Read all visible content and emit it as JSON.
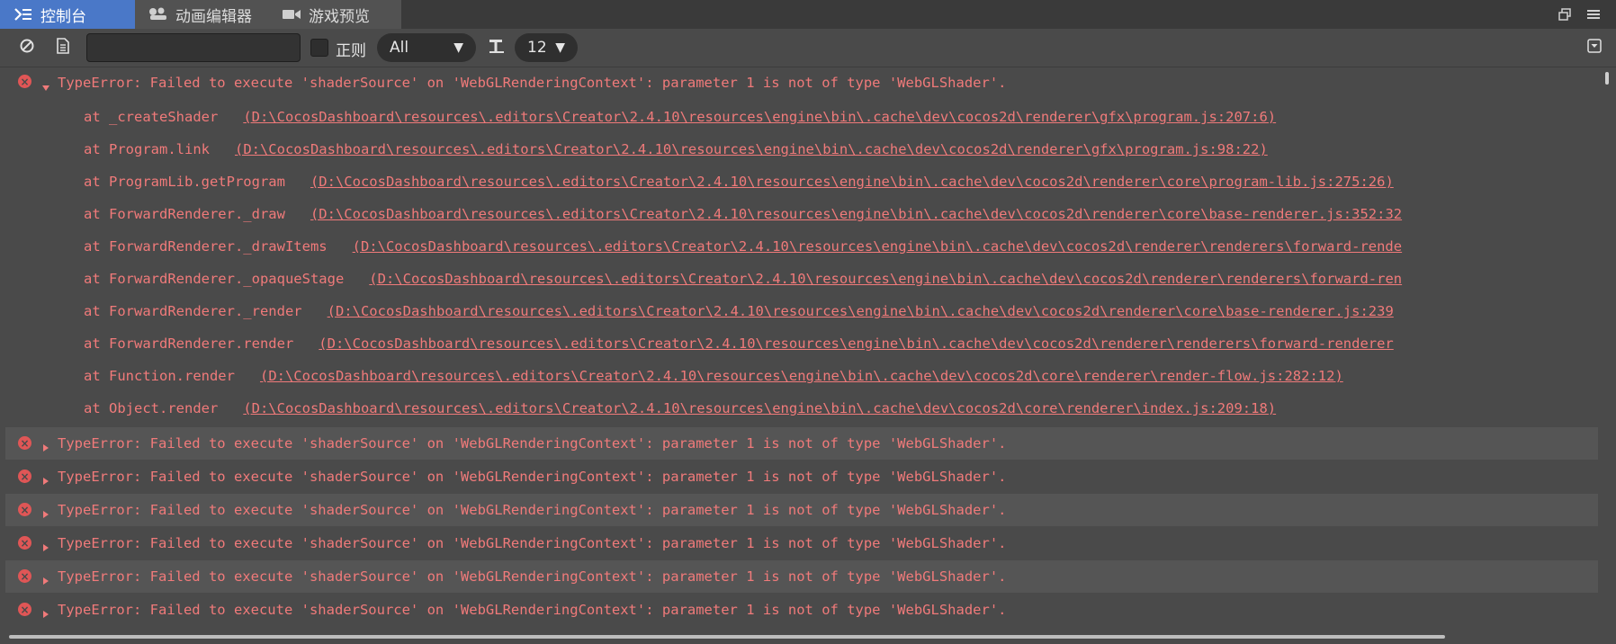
{
  "tabs": [
    {
      "label": "控制台",
      "icon": "console-icon",
      "active": true
    },
    {
      "label": "动画编辑器",
      "icon": "animation-icon",
      "active": false
    },
    {
      "label": "游戏预览",
      "icon": "camera-icon",
      "active": false
    }
  ],
  "window_controls": [
    "restore-window-icon",
    "menu-icon"
  ],
  "toolbar": {
    "clear_icon": "clear-icon",
    "open_log_icon": "document-icon",
    "search_value": "",
    "regex_label": "正则",
    "level_filter": "All",
    "font_icon": "font-size-icon",
    "font_size": "12",
    "collapse_icon": "collapse-icon"
  },
  "expanded_error": {
    "message": "TypeError: Failed to execute 'shaderSource' on 'WebGLRenderingContext': parameter 1 is not of type 'WebGLShader'.",
    "stack": [
      {
        "fn": "at _createShader",
        "loc": "(D:\\CocosDashboard\\resources\\.editors\\Creator\\2.4.10\\resources\\engine\\bin\\.cache\\dev\\cocos2d\\renderer\\gfx\\program.js:207:6)"
      },
      {
        "fn": "at Program.link",
        "loc": "(D:\\CocosDashboard\\resources\\.editors\\Creator\\2.4.10\\resources\\engine\\bin\\.cache\\dev\\cocos2d\\renderer\\gfx\\program.js:98:22)"
      },
      {
        "fn": "at ProgramLib.getProgram",
        "loc": "(D:\\CocosDashboard\\resources\\.editors\\Creator\\2.4.10\\resources\\engine\\bin\\.cache\\dev\\cocos2d\\renderer\\core\\program-lib.js:275:26)"
      },
      {
        "fn": "at ForwardRenderer._draw",
        "loc": "(D:\\CocosDashboard\\resources\\.editors\\Creator\\2.4.10\\resources\\engine\\bin\\.cache\\dev\\cocos2d\\renderer\\core\\base-renderer.js:352:32"
      },
      {
        "fn": "at ForwardRenderer._drawItems",
        "loc": "(D:\\CocosDashboard\\resources\\.editors\\Creator\\2.4.10\\resources\\engine\\bin\\.cache\\dev\\cocos2d\\renderer\\renderers\\forward-rende"
      },
      {
        "fn": "at ForwardRenderer._opaqueStage",
        "loc": "(D:\\CocosDashboard\\resources\\.editors\\Creator\\2.4.10\\resources\\engine\\bin\\.cache\\dev\\cocos2d\\renderer\\renderers\\forward-ren"
      },
      {
        "fn": "at ForwardRenderer._render",
        "loc": "(D:\\CocosDashboard\\resources\\.editors\\Creator\\2.4.10\\resources\\engine\\bin\\.cache\\dev\\cocos2d\\renderer\\core\\base-renderer.js:239"
      },
      {
        "fn": "at ForwardRenderer.render",
        "loc": "(D:\\CocosDashboard\\resources\\.editors\\Creator\\2.4.10\\resources\\engine\\bin\\.cache\\dev\\cocos2d\\renderer\\renderers\\forward-renderer"
      },
      {
        "fn": "at Function.render",
        "loc": "(D:\\CocosDashboard\\resources\\.editors\\Creator\\2.4.10\\resources\\engine\\bin\\.cache\\dev\\cocos2d\\core\\renderer\\render-flow.js:282:12)"
      },
      {
        "fn": "at Object.render",
        "loc": "(D:\\CocosDashboard\\resources\\.editors\\Creator\\2.4.10\\resources\\engine\\bin\\.cache\\dev\\cocos2d\\core\\renderer\\index.js:209:18)"
      }
    ]
  },
  "collapsed_errors": [
    "TypeError: Failed to execute 'shaderSource' on 'WebGLRenderingContext': parameter 1 is not of type 'WebGLShader'.",
    "TypeError: Failed to execute 'shaderSource' on 'WebGLRenderingContext': parameter 1 is not of type 'WebGLShader'.",
    "TypeError: Failed to execute 'shaderSource' on 'WebGLRenderingContext': parameter 1 is not of type 'WebGLShader'.",
    "TypeError: Failed to execute 'shaderSource' on 'WebGLRenderingContext': parameter 1 is not of type 'WebGLShader'.",
    "TypeError: Failed to execute 'shaderSource' on 'WebGLRenderingContext': parameter 1 is not of type 'WebGLShader'.",
    "TypeError: Failed to execute 'shaderSource' on 'WebGLRenderingContext': parameter 1 is not of type 'WebGLShader'."
  ],
  "colors": {
    "active_tab": "#4a78c8",
    "error_text": "#f07a7a",
    "error_icon": "#e05656",
    "panel_bg": "#4a4a4a"
  }
}
